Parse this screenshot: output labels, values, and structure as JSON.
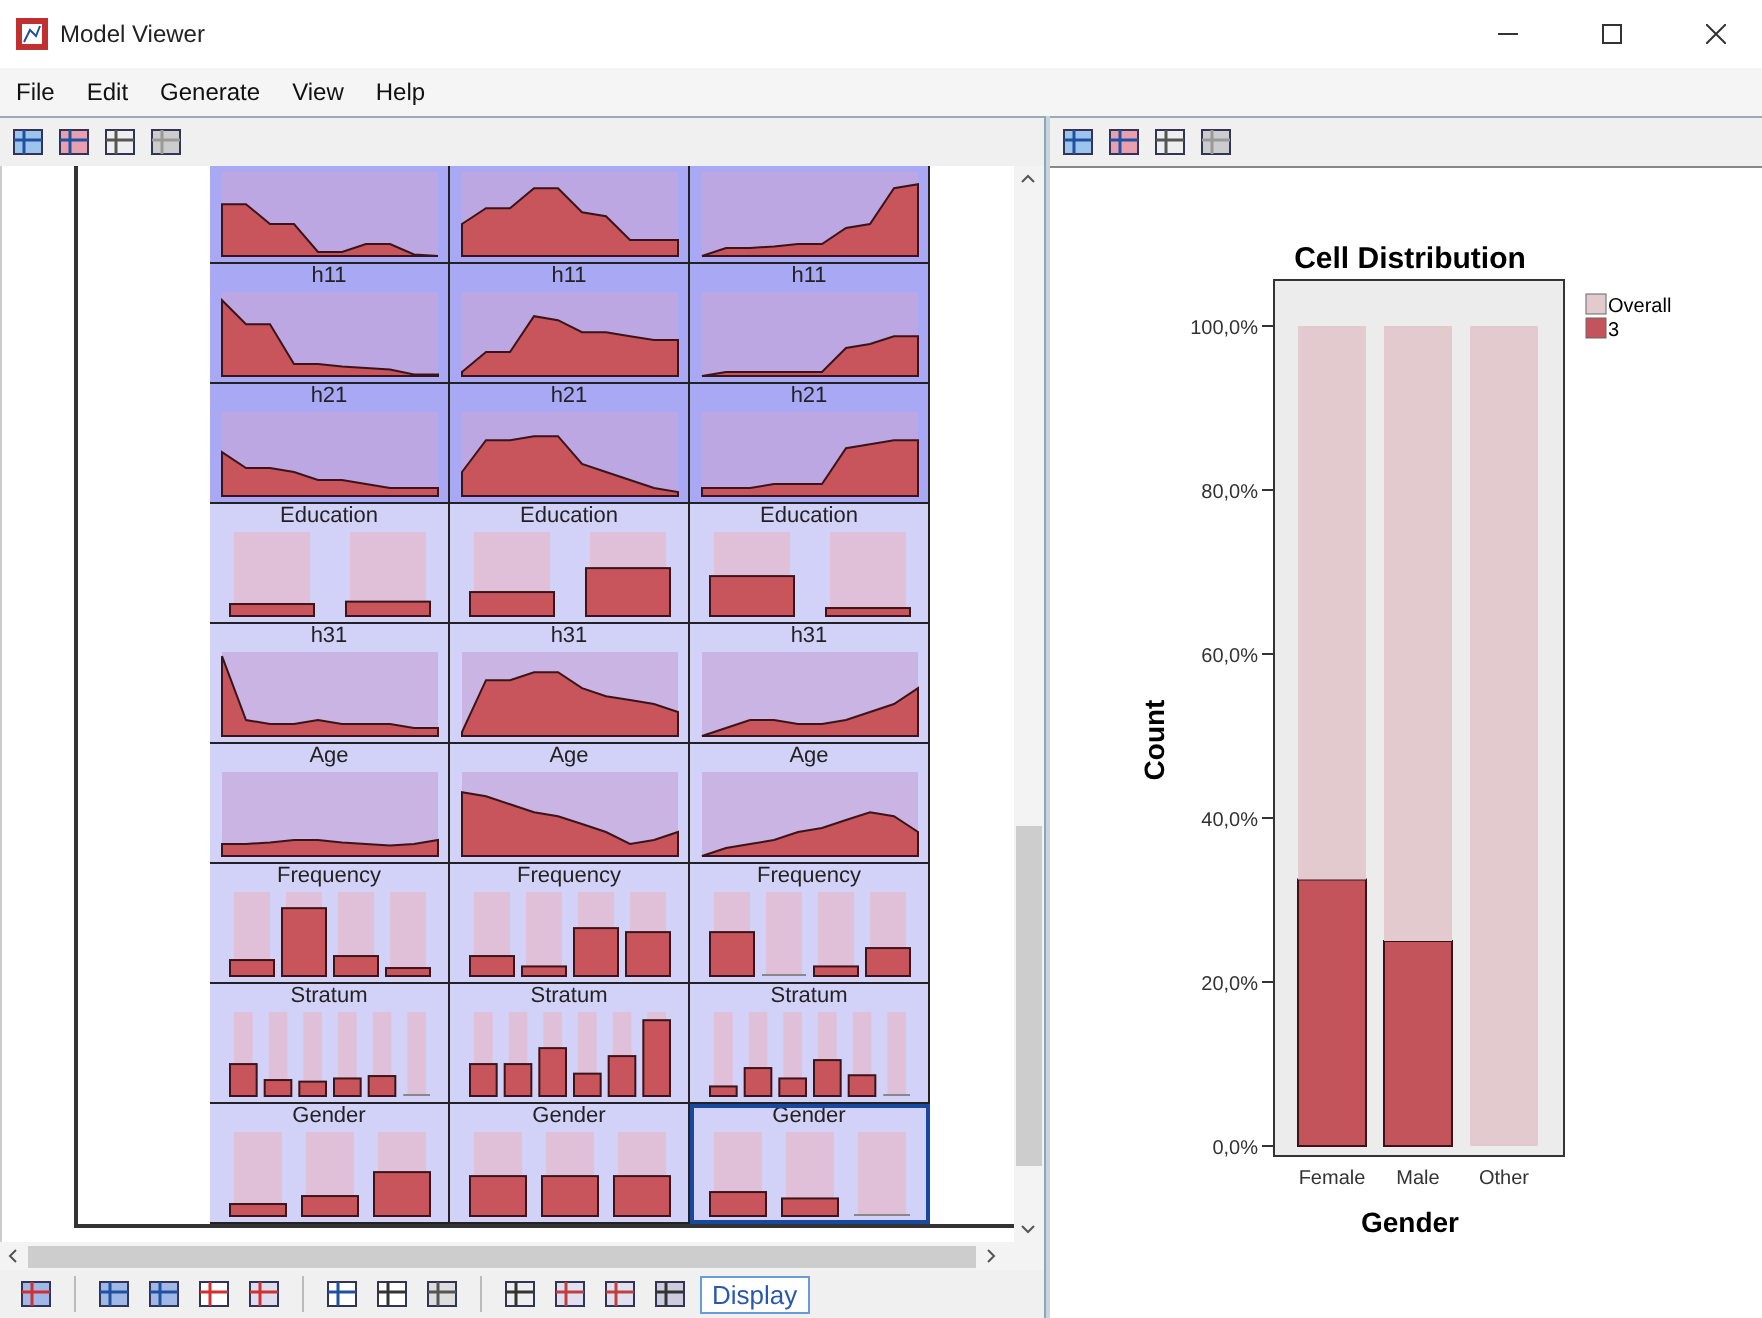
{
  "window": {
    "title": "Model Viewer"
  },
  "menu": [
    "File",
    "Edit",
    "Generate",
    "View",
    "Help"
  ],
  "grid": {
    "rows": [
      {
        "kind": "area",
        "cells": [
          {
            "selected": false
          },
          {
            "selected": false
          },
          {
            "selected": false
          }
        ]
      },
      {
        "kind": "area",
        "cells": [
          {
            "label": "h11",
            "selected": false
          },
          {
            "label": "h11",
            "selected": false
          },
          {
            "label": "h11",
            "selected": false
          }
        ]
      },
      {
        "kind": "area",
        "cells": [
          {
            "label": "h21",
            "selected": false
          },
          {
            "label": "h21",
            "selected": false
          },
          {
            "label": "h21",
            "selected": false
          }
        ]
      },
      {
        "kind": "bar",
        "cells": [
          {
            "label": "Education",
            "selected": false,
            "bars": [
              {
                "level": 0.15
              },
              {
                "level": 0.18
              }
            ]
          },
          {
            "label": "Education",
            "selected": false,
            "bars": [
              {
                "level": 0.3
              },
              {
                "level": 0.6
              }
            ]
          },
          {
            "label": "Education",
            "selected": false,
            "bars": [
              {
                "level": 0.5
              },
              {
                "level": 0.1
              }
            ]
          }
        ]
      },
      {
        "kind": "area",
        "cells": [
          {
            "label": "h31",
            "selected": false
          },
          {
            "label": "h31",
            "selected": false
          },
          {
            "label": "h31",
            "selected": false
          }
        ]
      },
      {
        "kind": "area",
        "cells": [
          {
            "label": "Age",
            "selected": false
          },
          {
            "label": "Age",
            "selected": false
          },
          {
            "label": "Age",
            "selected": false
          }
        ]
      },
      {
        "kind": "bar",
        "cells": [
          {
            "label": "Frequency",
            "selected": false,
            "bars": [
              {
                "level": 0.2
              },
              {
                "level": 0.85
              },
              {
                "level": 0.25
              },
              {
                "level": 0.1
              }
            ]
          },
          {
            "label": "Frequency",
            "selected": false,
            "bars": [
              {
                "level": 0.25
              },
              {
                "level": 0.12
              },
              {
                "level": 0.6
              },
              {
                "level": 0.55
              }
            ]
          },
          {
            "label": "Frequency",
            "selected": false,
            "bars": [
              {
                "level": 0.55
              },
              {
                "level": 0
              },
              {
                "level": 0.12
              },
              {
                "level": 0.35
              }
            ]
          }
        ]
      },
      {
        "kind": "bar",
        "cells": [
          {
            "label": "Stratum",
            "selected": false,
            "bars": [
              {
                "level": 0.4
              },
              {
                "level": 0.2
              },
              {
                "level": 0.18
              },
              {
                "level": 0.22
              },
              {
                "level": 0.25
              },
              {
                "level": 0
              }
            ]
          },
          {
            "label": "Stratum",
            "selected": false,
            "bars": [
              {
                "level": 0.4
              },
              {
                "level": 0.4
              },
              {
                "level": 0.6
              },
              {
                "level": 0.28
              },
              {
                "level": 0.5
              },
              {
                "level": 0.95
              }
            ]
          },
          {
            "label": "Stratum",
            "selected": false,
            "bars": [
              {
                "level": 0.12
              },
              {
                "level": 0.35
              },
              {
                "level": 0.22
              },
              {
                "level": 0.45
              },
              {
                "level": 0.26
              },
              {
                "level": 0
              }
            ]
          }
        ]
      },
      {
        "kind": "bar",
        "cells": [
          {
            "label": "Gender",
            "selected": false,
            "bars": [
              {
                "level": 0.15
              },
              {
                "level": 0.25
              },
              {
                "level": 0.55
              }
            ]
          },
          {
            "label": "Gender",
            "selected": false,
            "bars": [
              {
                "level": 0.5
              },
              {
                "level": 0.5
              },
              {
                "level": 0.5
              }
            ]
          },
          {
            "label": "Gender",
            "selected": true,
            "bars": [
              {
                "level": 0.3
              },
              {
                "level": 0.22
              },
              {
                "level": 0
              }
            ]
          }
        ]
      }
    ]
  },
  "display_button": "Display",
  "chart_data": {
    "type": "bar",
    "title": "Cell Distribution",
    "xlabel": "Gender",
    "ylabel": "Count",
    "categories": [
      "Female",
      "Male",
      "Other"
    ],
    "series": [
      {
        "name": "Overall",
        "color": "#e2cacf",
        "values": [
          67.5,
          75,
          100
        ]
      },
      {
        "name": "3",
        "color": "#c4545c",
        "values": [
          32.5,
          25,
          0
        ]
      }
    ],
    "stacked": true,
    "ylim": [
      0,
      100
    ],
    "yticks": [
      {
        "value": 0,
        "label": "0,0%"
      },
      {
        "value": 20,
        "label": "20,0%"
      },
      {
        "value": 40,
        "label": "40,0%"
      },
      {
        "value": 60,
        "label": "60,0%"
      },
      {
        "value": 80,
        "label": "80,0%"
      },
      {
        "value": 100,
        "label": "100,0%"
      }
    ]
  }
}
